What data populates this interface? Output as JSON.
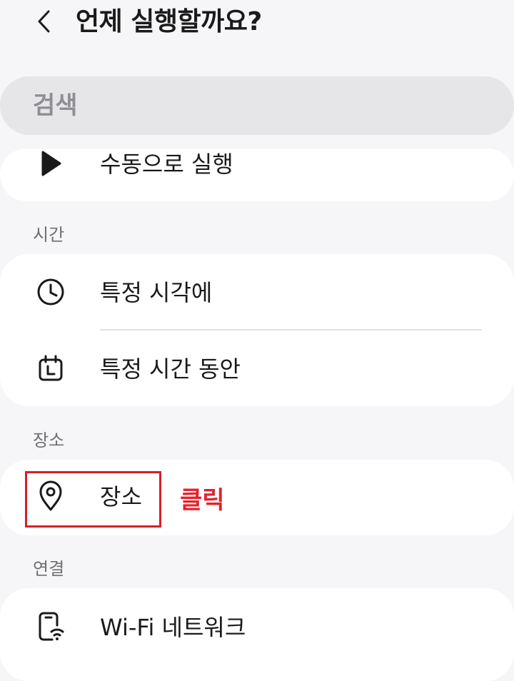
{
  "header": {
    "title": "언제 실행할까요?",
    "back_icon": "chevron-left-icon"
  },
  "search": {
    "placeholder": "검색"
  },
  "items": {
    "manual": {
      "label": "수동으로 실행",
      "icon": "play-icon"
    },
    "time_section": "시간",
    "specific_time": {
      "label": "특정 시각에",
      "icon": "clock-icon"
    },
    "time_period": {
      "label": "특정 시간 동안",
      "icon": "calendar-icon"
    },
    "place_section": "장소",
    "place": {
      "label": "장소",
      "icon": "location-pin-icon"
    },
    "connection_section": "연결",
    "wifi": {
      "label": "Wi-Fi 네트워크",
      "icon": "wifi-phone-icon"
    }
  },
  "annotation": {
    "text": "클릭",
    "color": "#e2232c"
  }
}
